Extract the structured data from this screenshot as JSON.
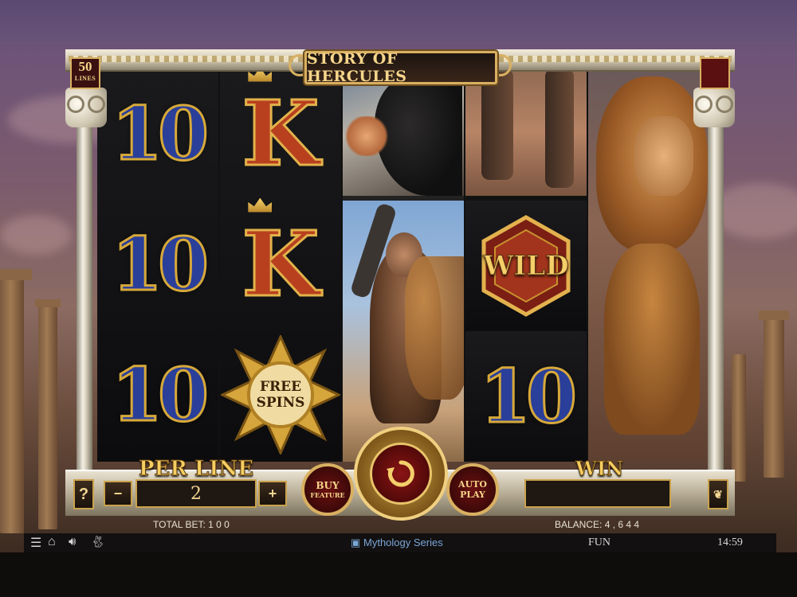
{
  "game": {
    "title": "STORY OF HERCULES",
    "lines_count": "50",
    "lines_label": "LINES"
  },
  "reels": {
    "reel1": [
      "10",
      "10",
      "10"
    ],
    "reel2": [
      "K",
      "K",
      "FREE SPINS"
    ],
    "wild_label": "WILD",
    "reel4_bottom": "10",
    "free_spins_line1": "FREE",
    "free_spins_line2": "SPINS"
  },
  "controls": {
    "help_label": "?",
    "per_line_label": "PER LINE",
    "minus_label": "−",
    "plus_label": "+",
    "per_line_value": "2",
    "buy_feature_line1": "BUY",
    "buy_feature_line2": "FEATURE",
    "auto_play_line1": "AUTO",
    "auto_play_line2": "PLAY",
    "win_label": "WIN",
    "win_value": ""
  },
  "status": {
    "total_bet_label": "TOTAL BET:",
    "total_bet_value": "1 0 0",
    "balance_label": "BALANCE:",
    "balance_value": "4 , 6 4 4"
  },
  "taskbar": {
    "series_label": "Mythology Series",
    "mode": "FUN",
    "clock": "14:59",
    "icons": [
      "menu-icon",
      "home-icon",
      "volume-icon",
      "rabbit-icon"
    ]
  },
  "colors": {
    "gold": "#d9b061",
    "ten_blue": "#2a3f9a",
    "k_red": "#b8401f",
    "panel_dark": "#1e1712"
  }
}
